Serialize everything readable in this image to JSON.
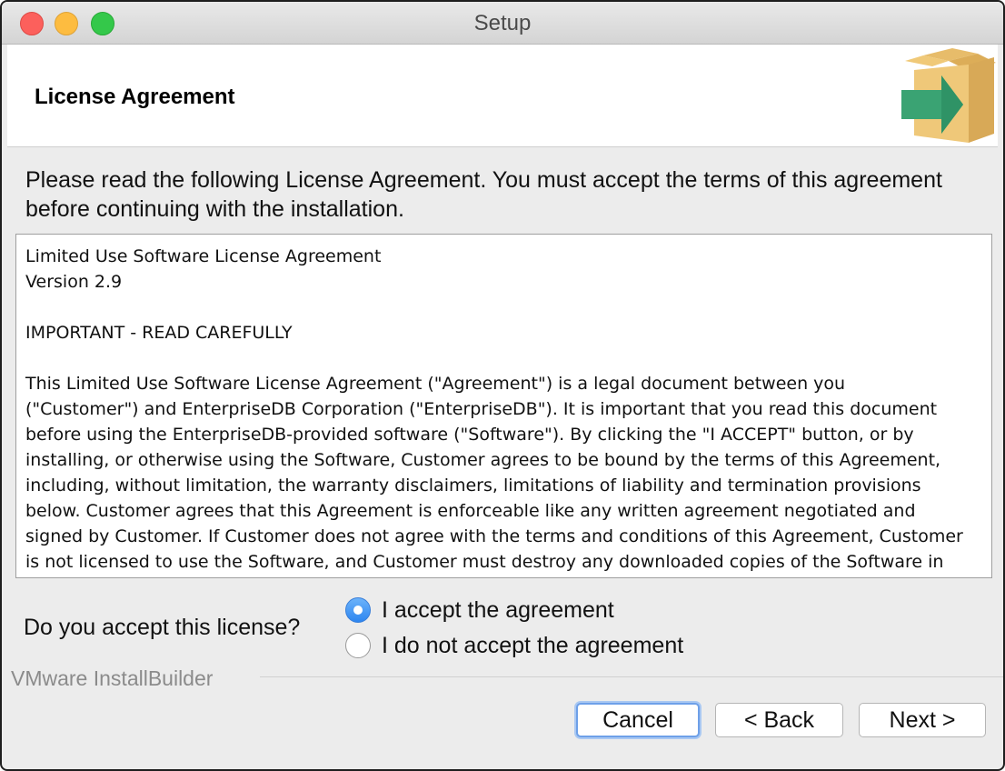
{
  "window": {
    "title": "Setup"
  },
  "header": {
    "title": "License Agreement",
    "icon": "install-box-arrow-icon"
  },
  "intro": "Please read the following License Agreement. You must accept the terms of this agreement before continuing with the installation.",
  "license": {
    "text": "Limited Use Software License Agreement\nVersion 2.9\n\nIMPORTANT - READ CAREFULLY\n\nThis Limited Use Software License Agreement (\"Agreement\") is a legal document between you\n(\"Customer\") and EnterpriseDB Corporation (\"EnterpriseDB\"). It is important that you read this document\nbefore using the EnterpriseDB-provided software (\"Software\"). By clicking the \"I ACCEPT\" button, or by\ninstalling, or otherwise using the Software, Customer agrees to be bound by the terms of this Agreement,\nincluding, without limitation, the warranty disclaimers, limitations of liability and termination provisions\nbelow. Customer agrees that this Agreement is enforceable like any written agreement negotiated and\nsigned by Customer. If Customer does not agree with the terms and conditions of this Agreement, Customer\nis not licensed to use the Software, and Customer must destroy any downloaded copies of the Software in"
  },
  "accept": {
    "question": "Do you accept this license?",
    "options": [
      {
        "label": "I accept the agreement",
        "selected": true
      },
      {
        "label": "I do not accept the agreement",
        "selected": false
      }
    ]
  },
  "footer": {
    "brand": "VMware InstallBuilder",
    "cancel": "Cancel",
    "back": "< Back",
    "next": "Next >"
  },
  "colors": {
    "accent": "#2d86f0",
    "close": "#fc605c",
    "minimize": "#fdbc40",
    "maximize": "#34c84a"
  }
}
